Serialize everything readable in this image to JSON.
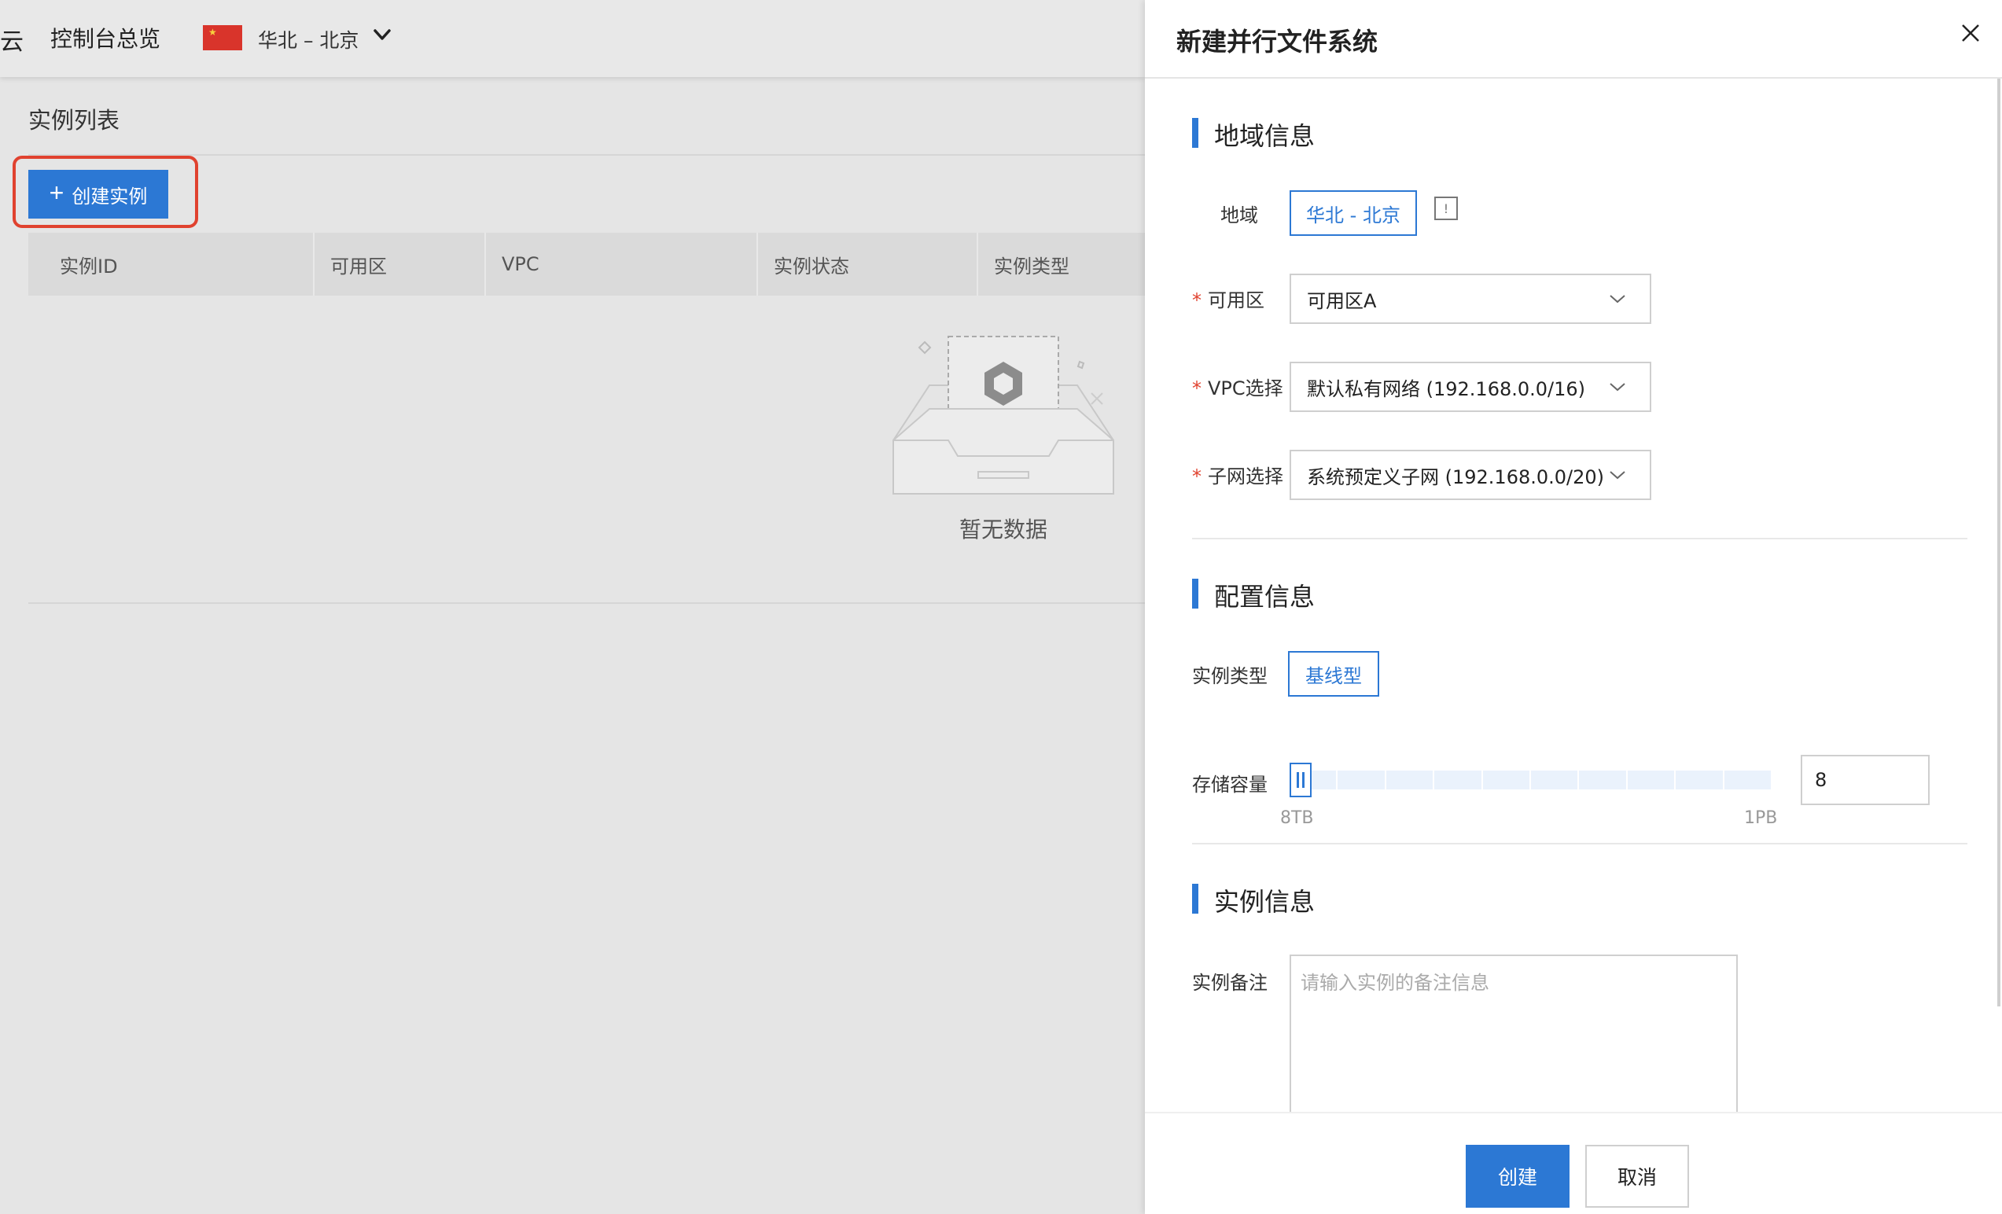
{
  "header": {
    "logo_fragment": "云",
    "console_title": "控制台总览",
    "region": "华北 – 北京"
  },
  "list": {
    "title": "实例列表",
    "create_button": "创建实例",
    "columns": [
      "实例ID",
      "可用区",
      "VPC",
      "实例状态",
      "实例类型"
    ],
    "empty_text": "暂无数据"
  },
  "drawer": {
    "title": "新建并行文件系统",
    "sections": {
      "region": {
        "title": "地域信息",
        "region_label": "地域",
        "region_value": "华北 - 北京",
        "info_badge": "!",
        "zone_label": "可用区",
        "zone_value": "可用区A",
        "vpc_label": "VPC选择",
        "vpc_value": "默认私有网络 (192.168.0.0/16)",
        "subnet_label": "子网选择",
        "subnet_value": "系统预定义子网 (192.168.0.0/20)",
        "required_mark": "*"
      },
      "config": {
        "title": "配置信息",
        "type_label": "实例类型",
        "type_value": "基线型",
        "capacity_label": "存储容量",
        "slider_min": "8TB",
        "slider_max": "1PB",
        "capacity_value": "8",
        "slider_level_percent": 0
      },
      "instance": {
        "title": "实例信息",
        "note_label": "实例备注",
        "note_placeholder": "请输入实例的备注信息"
      }
    },
    "buttons": {
      "create": "创建",
      "cancel": "取消"
    }
  },
  "colors": {
    "accent": "#2c78d4",
    "highlight": "#e0422f",
    "required": "#e0422f"
  }
}
